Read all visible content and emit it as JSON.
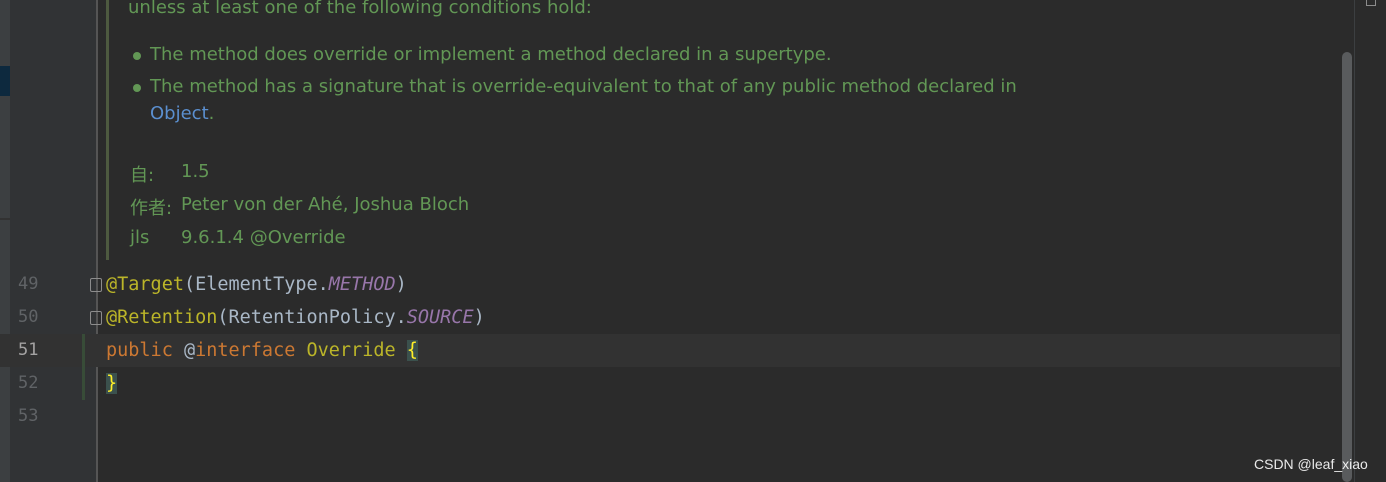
{
  "doc": {
    "intro": "unless at least one of the following conditions hold:",
    "bullets": [
      {
        "text": "The method does override or implement a method declared in a supertype."
      },
      {
        "text": "The method has a signature that is override-equivalent to that of any public method declared in",
        "link": "Object",
        "suffix": "."
      }
    ],
    "tags": [
      {
        "label": "自:",
        "value": "1.5"
      },
      {
        "label": "作者:",
        "value": "Peter von der Ahé, Joshua Bloch"
      },
      {
        "label": "jls",
        "value": "9.6.1.4 @Override"
      }
    ]
  },
  "code": {
    "current_line": 51,
    "lines": [
      {
        "number": "49",
        "annotation": "@Target",
        "open": "(",
        "type": "ElementType",
        "dot": ".",
        "constant": "METHOD",
        "close": ")"
      },
      {
        "number": "50",
        "annotation": "@Retention",
        "open": "(",
        "type": "RetentionPolicy",
        "dot": ".",
        "constant": "SOURCE",
        "close": ")"
      },
      {
        "number": "51",
        "kw_public": "public",
        "at": "@",
        "kw_interface": "interface",
        "name": "Override",
        "brace": "{"
      },
      {
        "number": "52",
        "brace": "}"
      },
      {
        "number": "53"
      }
    ]
  },
  "watermark": "CSDN @leaf_xiao",
  "colors": {
    "background": "#2b2b2b",
    "doc_text": "#629755",
    "annotation": "#bbb529",
    "keyword": "#cc7832",
    "static_field": "#9876aa",
    "link": "#5b8fcf"
  }
}
